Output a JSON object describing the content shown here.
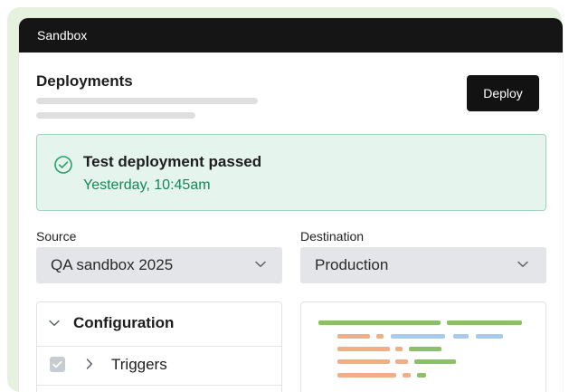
{
  "window": {
    "title": "Sandbox"
  },
  "deployments": {
    "title": "Deployments",
    "deploy_button": "Deploy"
  },
  "status": {
    "title": "Test deployment passed",
    "subtitle": "Yesterday, 10:45am",
    "icon": "check-circle-icon"
  },
  "source": {
    "label": "Source",
    "value": "QA sandbox 2025",
    "icon": "chevron-down-icon"
  },
  "destination": {
    "label": "Destination",
    "value": "Production",
    "icon": "chevron-down-icon"
  },
  "configuration": {
    "title": "Configuration",
    "icon": "chevron-down-icon",
    "items": [
      {
        "label": "Triggers",
        "icon": "chevron-right-icon"
      }
    ]
  },
  "colors": {
    "titlebar": "#151515",
    "accent": "#121212",
    "success": "#11885a",
    "success_bg": "#e6f4ee",
    "code_green": "#8bc06a",
    "code_orange": "#f0ae86",
    "code_blue": "#a9cbe9"
  }
}
